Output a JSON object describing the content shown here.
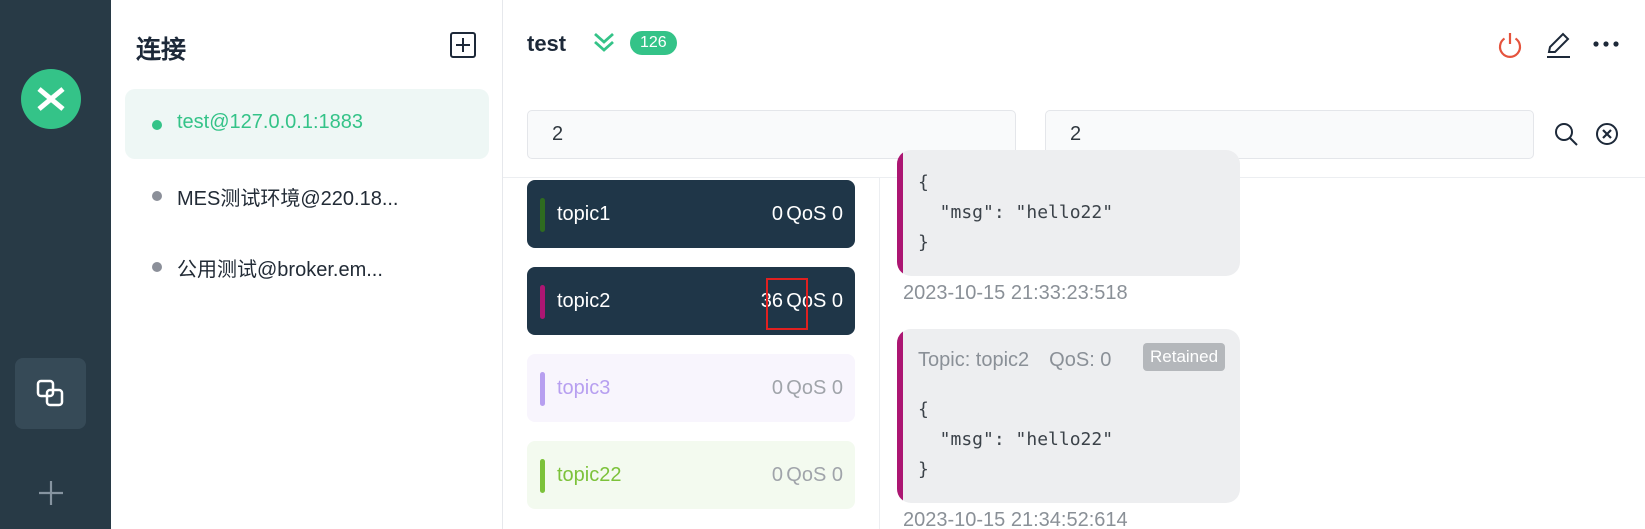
{
  "sidebar": {
    "logo_icon": "mqttx-logo-icon",
    "connections_icon": "connections-icon",
    "new_icon": "plus-icon"
  },
  "connections": {
    "title": "连接",
    "add_icon": "add-square-icon",
    "items": [
      {
        "label": "test@127.0.0.1:1883",
        "status": "connected",
        "active": true
      },
      {
        "label": "MES测试环境@220.18...",
        "status": "disconnected",
        "active": false
      },
      {
        "label": "公用测试@broker.em...",
        "status": "disconnected",
        "active": false
      }
    ]
  },
  "header": {
    "title": "test",
    "chevron_icon": "double-chevron-down-icon",
    "badge": "126",
    "actions": [
      "power-icon",
      "edit-icon",
      "more-icon"
    ]
  },
  "filters": {
    "topic_value": "2",
    "payload_value": "2",
    "search_icon": "search-icon",
    "clear_icon": "clear-circle-icon"
  },
  "topics": [
    {
      "name": "topic1",
      "count": "0",
      "qos": "QoS 0",
      "color": "#2e6b1f",
      "style": "dark"
    },
    {
      "name": "topic2",
      "count": "36",
      "qos": "QoS 0",
      "color": "#ac1672",
      "style": "dark"
    },
    {
      "name": "topic3",
      "count": "0",
      "qos": "QoS 0",
      "color": "#b79ff0",
      "style": "purple"
    },
    {
      "name": "topic22",
      "count": "0",
      "qos": "QoS 0",
      "color": "#7cc23a",
      "style": "green"
    }
  ],
  "messages": [
    {
      "payload": "{\n  \"msg\": \"hello22\"\n}",
      "time": "2023-10-15 21:33:23:518"
    },
    {
      "topic_label": "Topic: topic2",
      "qos_label": "QoS: 0",
      "retained": "Retained",
      "payload": "{\n  \"msg\": \"hello22\"\n}",
      "time": "2023-10-15 21:34:52:614"
    }
  ],
  "colors": {
    "accent": "#34c388",
    "rail": "#283a46",
    "topic_dark": "#1f3648",
    "message_bar": "#ac1672"
  }
}
